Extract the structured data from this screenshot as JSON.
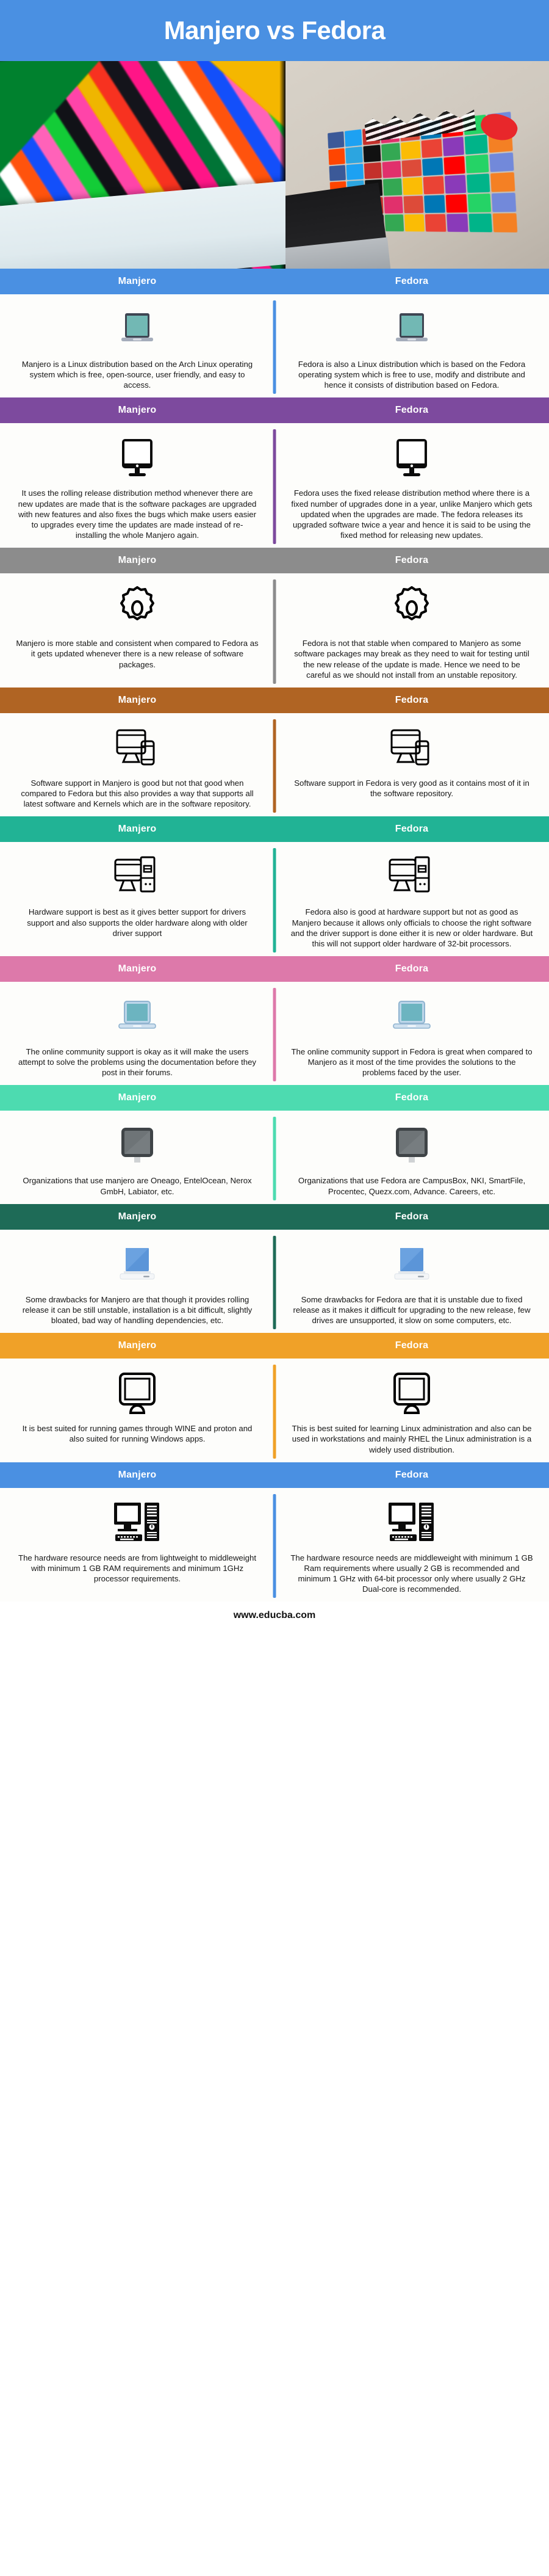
{
  "header": {
    "title": "Manjero vs Fedora",
    "bar_color": "#4a90e2"
  },
  "hero": {
    "left_alt": "laptop-with-colorful-triangle-wallpaper",
    "right_alt": "laptop-screen-with-social-media-icon-grid"
  },
  "left_label": "Manjero",
  "right_label": "Fedora",
  "footer": {
    "url": "www.educba.com"
  },
  "sections": [
    {
      "id": "definition",
      "color": "#4a90e2",
      "icon": "laptop-icon",
      "icon_style": "teal-laptop",
      "left_label": "Manjero",
      "right_label": "Fedora",
      "left_text": "Manjero is a Linux distribution based on the Arch Linux operating system which is free, open-source, user friendly, and easy to access.",
      "right_text": "Fedora is also a Linux distribution which is based on the Fedora operating system which is free to use, modify and distribute and hence it consists of distribution based on Fedora."
    },
    {
      "id": "release-method",
      "color": "#7d4a9e",
      "icon": "monitor-icon",
      "icon_style": "black-monitor-solid",
      "left_label": "Manjero",
      "right_label": "Fedora",
      "left_text": "It uses the rolling release distribution method whenever there are new updates are made that is the software packages are upgraded with new features and also fixes the bugs which make users easier to upgrades every time the updates are made instead of re-installing the whole Manjero again.",
      "right_text": "Fedora uses the fixed release distribution method where there is a fixed number of upgrades done in a year, unlike Manjero which gets updated when the upgrades are made. The fedora releases its upgraded software twice a year and hence it is said to be using the fixed method for releasing new updates."
    },
    {
      "id": "stability",
      "color": "#8c8c8c",
      "icon": "gear-icon",
      "icon_style": "gear-outline",
      "left_label": "Manjero",
      "right_label": "Fedora",
      "left_text": "Manjero is more stable and consistent when compared to Fedora as it gets updated whenever there is a new release of software packages.",
      "right_text": "Fedora is not that stable when compared to Manjero as some software packages may break as they need to wait for testing until the new release of the update is made. Hence we need to be careful as we should not install from an unstable repository."
    },
    {
      "id": "software-support",
      "color": "#b06423",
      "icon": "monitor-and-phone-icon",
      "icon_style": "monitor-phone-outline",
      "left_label": "Manjero",
      "right_label": "Fedora",
      "left_text": "Software support in Manjero is good but not that good when compared to Fedora but this also provides a way that supports all latest software and Kernels which are in the software repository.",
      "right_text": "Software support in Fedora is very good as it contains most of it in the software repository."
    },
    {
      "id": "hardware-support",
      "color": "#21b395",
      "icon": "desktop-tower-icon",
      "icon_style": "monitor-tower-outline",
      "left_label": "Manjero",
      "right_label": "Fedora",
      "left_text": "Hardware support is best as it gives better support for drivers support and also supports the older hardware along with older driver support",
      "right_text": "Fedora also is good at hardware support but not as good as Manjero because it allows only officials to choose the right software and the driver support is done either it is new or older hardware. But this will not support older hardware of 32-bit processors."
    },
    {
      "id": "community-support",
      "color": "#dd79aa",
      "icon": "laptop-icon",
      "icon_style": "blue-laptop",
      "left_label": "Manjero",
      "right_label": "Fedora",
      "left_text": "The online community support is okay as it will make the users attempt to solve the problems using the documentation before they post in their forums.",
      "right_text": "The online community support in Fedora is great when compared to Manjero as it most of the time provides the solutions to the problems faced by the user."
    },
    {
      "id": "organizations",
      "color": "#4ddbb0",
      "icon": "monitor-icon",
      "icon_style": "grey-monitor",
      "left_label": "Manjero",
      "right_label": "Fedora",
      "left_text": "Organizations that use manjero are Oneago, EntelOcean, Nerox GmbH, Labiator, etc.",
      "right_text": "Organizations that use Fedora are CampusBox, NKI, SmartFile, Procentec, Quezx.com, Advance. Careers, etc."
    },
    {
      "id": "drawbacks",
      "color": "#1e6b57",
      "icon": "laptop-icon",
      "icon_style": "blue-flat-laptop",
      "left_label": "Manjero",
      "right_label": "Fedora",
      "left_text": "Some drawbacks for Manjero are that though it provides rolling release it can be still unstable, installation is a bit difficult, slightly bloated, bad way of handling dependencies, etc.",
      "right_text": "Some drawbacks for Fedora are that it is unstable due to fixed release as it makes it difficult for upgrading to the new release, few drives are unsupported, it slow on some computers, etc."
    },
    {
      "id": "best-suited",
      "color": "#f0a128",
      "icon": "monitor-icon",
      "icon_style": "monitor-outline-round",
      "left_label": "Manjero",
      "right_label": "Fedora",
      "left_text": "It is best suited for running games through WINE and proton and also suited for running Windows apps.",
      "right_text": "This is best suited for learning Linux administration and also can be used in workstations and mainly RHEL the Linux administration is a widely used distribution."
    },
    {
      "id": "hardware-resources",
      "color": "#4a90e2",
      "icon": "desktop-computer-icon",
      "icon_style": "pc-solid",
      "left_label": "Manjero",
      "right_label": "Fedora",
      "left_text": "The hardware resource needs are from lightweight to middleweight with minimum 1 GB RAM requirements and minimum 1GHz processor requirements.",
      "right_text": "The hardware resource needs are middleweight with minimum 1 GB Ram requirements where usually 2 GB is recommended and minimum 1 GHz with 64-bit processor only where usually 2 GHz Dual-core is recommended."
    }
  ]
}
